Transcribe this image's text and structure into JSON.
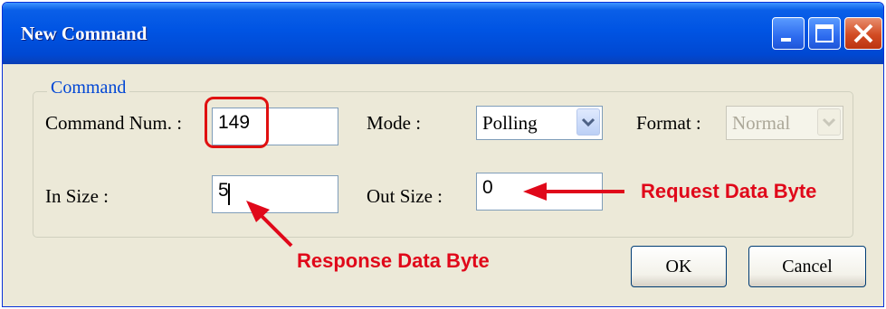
{
  "window": {
    "title": "New Command"
  },
  "titlebar_buttons": {
    "minimize": "minimize-icon",
    "maximize": "maximize-icon",
    "close": "close-icon"
  },
  "group": {
    "legend": "Command"
  },
  "fields": {
    "command_num": {
      "label": "Command Num. :",
      "value": "149"
    },
    "mode": {
      "label": "Mode :",
      "value": "Polling"
    },
    "format": {
      "label": "Format :",
      "value": "Normal",
      "enabled": false
    },
    "in_size": {
      "label": "In Size :",
      "value": "5"
    },
    "out_size": {
      "label": "Out Size :",
      "value": "0"
    }
  },
  "buttons": {
    "ok": "OK",
    "cancel": "Cancel"
  },
  "annotations": {
    "request": "Request Data Byte",
    "response": "Response Data Byte",
    "color": "#e0081a"
  }
}
